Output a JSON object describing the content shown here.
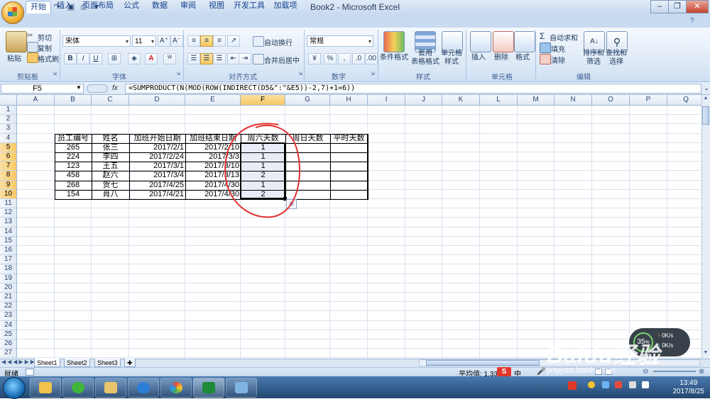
{
  "window": {
    "title": "Book2 - Microsoft Excel"
  },
  "ribbon": {
    "tabs": [
      "开始",
      "插入",
      "页面布局",
      "公式",
      "数据",
      "审阅",
      "视图",
      "开发工具",
      "加载项"
    ],
    "active_tab": "开始",
    "clipboard": {
      "paste": "粘贴",
      "cut": "剪切",
      "copy": "复制",
      "format_painter": "格式刷",
      "group": "剪贴板"
    },
    "font": {
      "name": "宋体",
      "size": "11",
      "bold": "B",
      "italic": "I",
      "underline": "U",
      "group": "字体"
    },
    "alignment": {
      "wrap": "自动换行",
      "merge": "合并后居中",
      "group": "对齐方式"
    },
    "number": {
      "format": "常规",
      "percent": "%",
      "comma": ",",
      "group": "数字"
    },
    "styles": {
      "conditional": "条件格式",
      "table_format": "套用\n表格格式",
      "cell_style": "单元格\n样式",
      "group": "样式"
    },
    "cells": {
      "insert": "插入",
      "delete": "删除",
      "format": "格式",
      "group": "单元格"
    },
    "editing": {
      "autosum": "自动求和",
      "fill": "填充",
      "clear": "清除",
      "sort": "排序和\n筛选",
      "find": "查找和\n选择",
      "group": "编辑"
    }
  },
  "formula_bar": {
    "name_box": "F5",
    "fx": "fx",
    "formula": "=SUMPRODUCT(N(MOD(ROW(INDIRECT(D5&\":\"&E5))-2,7)+1=6))"
  },
  "sheet": {
    "columns": [
      "A",
      "B",
      "C",
      "D",
      "E",
      "F",
      "G",
      "H",
      "I",
      "J",
      "K",
      "L",
      "M",
      "N",
      "O",
      "P",
      "Q"
    ],
    "selected_column": "F",
    "rows": [
      "1",
      "2",
      "3",
      "4",
      "5",
      "6",
      "7",
      "8",
      "9",
      "10",
      "11",
      "12",
      "13",
      "14",
      "15",
      "16",
      "17",
      "18",
      "19",
      "20",
      "21",
      "22",
      "23",
      "24",
      "25",
      "26",
      "27"
    ],
    "selected_rows": [
      "5",
      "6",
      "7",
      "8",
      "9",
      "10"
    ],
    "table_headers": [
      "员工编号",
      "姓名",
      "加班开始日期",
      "加班结束日期",
      "周六天数",
      "周日天数",
      "平时天数"
    ],
    "table_rows": [
      [
        "265",
        "张三",
        "2017/2/1",
        "2017/2/10",
        "1",
        "",
        ""
      ],
      [
        "224",
        "李四",
        "2017/2/24",
        "2017/3/3",
        "1",
        "",
        ""
      ],
      [
        "123",
        "王五",
        "2017/3/1",
        "2017/3/10",
        "1",
        "",
        ""
      ],
      [
        "458",
        "赵六",
        "2017/3/4",
        "2017/3/13",
        "2",
        "",
        ""
      ],
      [
        "268",
        "贺七",
        "2017/4/25",
        "2017/4/30",
        "1",
        "",
        ""
      ],
      [
        "154",
        "肖八",
        "2017/4/21",
        "2017/4/30",
        "2",
        "",
        ""
      ]
    ]
  },
  "sheet_tabs": [
    "Sheet1",
    "Sheet2",
    "Sheet3"
  ],
  "status": {
    "ready": "就绪",
    "average": "平均值: 1.333",
    "ime": "中",
    "zoom": "100%"
  },
  "net_widget": {
    "percent": "35",
    "percent_unit": "%",
    "up": "0K/s",
    "down": "0K/s"
  },
  "watermark": {
    "text": "Baidu经验",
    "url": "jingyan.baidu.com"
  },
  "taskbar": {
    "time": "13:49",
    "date": "2017/8/25"
  },
  "colors": {
    "accent": "#15428b",
    "selection": "#f8c865",
    "ribbon_bg": "#dce8f6",
    "annotation": "#e03030"
  }
}
